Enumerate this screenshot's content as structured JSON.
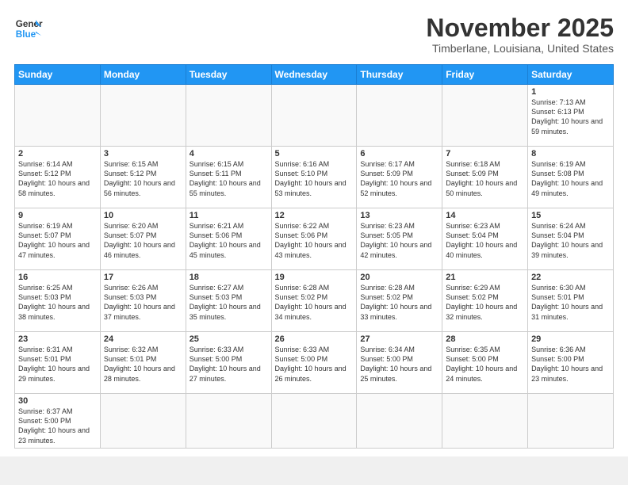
{
  "header": {
    "logo_line1": "General",
    "logo_line2": "Blue",
    "month": "November 2025",
    "location": "Timberlane, Louisiana, United States"
  },
  "weekdays": [
    "Sunday",
    "Monday",
    "Tuesday",
    "Wednesday",
    "Thursday",
    "Friday",
    "Saturday"
  ],
  "weeks": [
    [
      {
        "day": "",
        "info": ""
      },
      {
        "day": "",
        "info": ""
      },
      {
        "day": "",
        "info": ""
      },
      {
        "day": "",
        "info": ""
      },
      {
        "day": "",
        "info": ""
      },
      {
        "day": "",
        "info": ""
      },
      {
        "day": "1",
        "info": "Sunrise: 7:13 AM\nSunset: 6:13 PM\nDaylight: 10 hours and 59 minutes."
      }
    ],
    [
      {
        "day": "2",
        "info": "Sunrise: 6:14 AM\nSunset: 5:12 PM\nDaylight: 10 hours and 58 minutes."
      },
      {
        "day": "3",
        "info": "Sunrise: 6:15 AM\nSunset: 5:12 PM\nDaylight: 10 hours and 56 minutes."
      },
      {
        "day": "4",
        "info": "Sunrise: 6:15 AM\nSunset: 5:11 PM\nDaylight: 10 hours and 55 minutes."
      },
      {
        "day": "5",
        "info": "Sunrise: 6:16 AM\nSunset: 5:10 PM\nDaylight: 10 hours and 53 minutes."
      },
      {
        "day": "6",
        "info": "Sunrise: 6:17 AM\nSunset: 5:09 PM\nDaylight: 10 hours and 52 minutes."
      },
      {
        "day": "7",
        "info": "Sunrise: 6:18 AM\nSunset: 5:09 PM\nDaylight: 10 hours and 50 minutes."
      },
      {
        "day": "8",
        "info": "Sunrise: 6:19 AM\nSunset: 5:08 PM\nDaylight: 10 hours and 49 minutes."
      }
    ],
    [
      {
        "day": "9",
        "info": "Sunrise: 6:19 AM\nSunset: 5:07 PM\nDaylight: 10 hours and 47 minutes."
      },
      {
        "day": "10",
        "info": "Sunrise: 6:20 AM\nSunset: 5:07 PM\nDaylight: 10 hours and 46 minutes."
      },
      {
        "day": "11",
        "info": "Sunrise: 6:21 AM\nSunset: 5:06 PM\nDaylight: 10 hours and 45 minutes."
      },
      {
        "day": "12",
        "info": "Sunrise: 6:22 AM\nSunset: 5:06 PM\nDaylight: 10 hours and 43 minutes."
      },
      {
        "day": "13",
        "info": "Sunrise: 6:23 AM\nSunset: 5:05 PM\nDaylight: 10 hours and 42 minutes."
      },
      {
        "day": "14",
        "info": "Sunrise: 6:23 AM\nSunset: 5:04 PM\nDaylight: 10 hours and 40 minutes."
      },
      {
        "day": "15",
        "info": "Sunrise: 6:24 AM\nSunset: 5:04 PM\nDaylight: 10 hours and 39 minutes."
      }
    ],
    [
      {
        "day": "16",
        "info": "Sunrise: 6:25 AM\nSunset: 5:03 PM\nDaylight: 10 hours and 38 minutes."
      },
      {
        "day": "17",
        "info": "Sunrise: 6:26 AM\nSunset: 5:03 PM\nDaylight: 10 hours and 37 minutes."
      },
      {
        "day": "18",
        "info": "Sunrise: 6:27 AM\nSunset: 5:03 PM\nDaylight: 10 hours and 35 minutes."
      },
      {
        "day": "19",
        "info": "Sunrise: 6:28 AM\nSunset: 5:02 PM\nDaylight: 10 hours and 34 minutes."
      },
      {
        "day": "20",
        "info": "Sunrise: 6:28 AM\nSunset: 5:02 PM\nDaylight: 10 hours and 33 minutes."
      },
      {
        "day": "21",
        "info": "Sunrise: 6:29 AM\nSunset: 5:02 PM\nDaylight: 10 hours and 32 minutes."
      },
      {
        "day": "22",
        "info": "Sunrise: 6:30 AM\nSunset: 5:01 PM\nDaylight: 10 hours and 31 minutes."
      }
    ],
    [
      {
        "day": "23",
        "info": "Sunrise: 6:31 AM\nSunset: 5:01 PM\nDaylight: 10 hours and 29 minutes."
      },
      {
        "day": "24",
        "info": "Sunrise: 6:32 AM\nSunset: 5:01 PM\nDaylight: 10 hours and 28 minutes."
      },
      {
        "day": "25",
        "info": "Sunrise: 6:33 AM\nSunset: 5:00 PM\nDaylight: 10 hours and 27 minutes."
      },
      {
        "day": "26",
        "info": "Sunrise: 6:33 AM\nSunset: 5:00 PM\nDaylight: 10 hours and 26 minutes."
      },
      {
        "day": "27",
        "info": "Sunrise: 6:34 AM\nSunset: 5:00 PM\nDaylight: 10 hours and 25 minutes."
      },
      {
        "day": "28",
        "info": "Sunrise: 6:35 AM\nSunset: 5:00 PM\nDaylight: 10 hours and 24 minutes."
      },
      {
        "day": "29",
        "info": "Sunrise: 6:36 AM\nSunset: 5:00 PM\nDaylight: 10 hours and 23 minutes."
      }
    ],
    [
      {
        "day": "30",
        "info": "Sunrise: 6:37 AM\nSunset: 5:00 PM\nDaylight: 10 hours and 23 minutes."
      },
      {
        "day": "",
        "info": ""
      },
      {
        "day": "",
        "info": ""
      },
      {
        "day": "",
        "info": ""
      },
      {
        "day": "",
        "info": ""
      },
      {
        "day": "",
        "info": ""
      },
      {
        "day": "",
        "info": ""
      }
    ]
  ]
}
